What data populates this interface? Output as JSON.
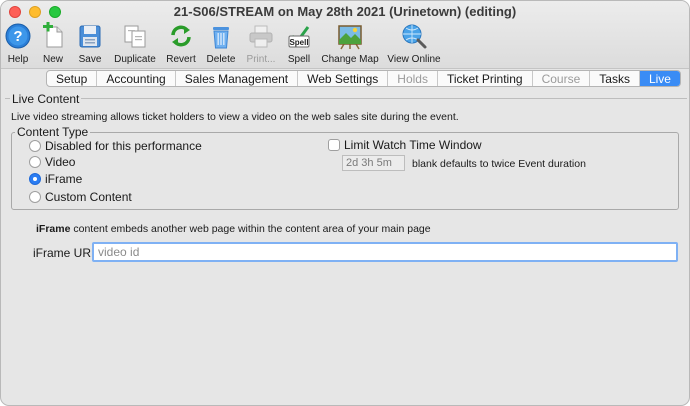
{
  "window": {
    "title": "21-S06/STREAM on May 28th 2021 (Urinetown) (editing)"
  },
  "toolbar": {
    "help": "Help",
    "new": "New",
    "save": "Save",
    "duplicate": "Duplicate",
    "revert": "Revert",
    "delete": "Delete",
    "print": "Print...",
    "spell": "Spell",
    "spell_badge": "Spell",
    "change_map": "Change Map",
    "view_online": "View Online"
  },
  "tabs": {
    "setup": "Setup",
    "accounting": "Accounting",
    "sales_management": "Sales Management",
    "web_settings": "Web Settings",
    "holds": "Holds",
    "ticket_printing": "Ticket Printing",
    "course": "Course",
    "tasks": "Tasks",
    "live": "Live",
    "active": "Live",
    "disabled": [
      "Holds",
      "Course"
    ]
  },
  "live": {
    "section_title": "Live Content",
    "description": "Live video streaming allows ticket holders to view a video on the web sales site during the event.",
    "content_type": {
      "title": "Content Type",
      "options": {
        "disabled": "Disabled for this performance",
        "video": "Video",
        "iframe": "iFrame",
        "custom": "Custom Content"
      },
      "selected": "iFrame"
    },
    "limit_watch": {
      "label": "Limit Watch Time Window",
      "checked": false,
      "duration_value": "2d 3h 5m",
      "hint": "blank defaults to twice Event duration"
    },
    "iframe_note_bold": "iFrame",
    "iframe_note_rest": " content embeds another web page within the content area of your main page",
    "iframe_url_label": "iFrame URL",
    "iframe_url_value": "",
    "iframe_url_placeholder": "video id"
  },
  "colors": {
    "accent": "#3a8cf5",
    "window_bg": "#e6e6e6"
  }
}
